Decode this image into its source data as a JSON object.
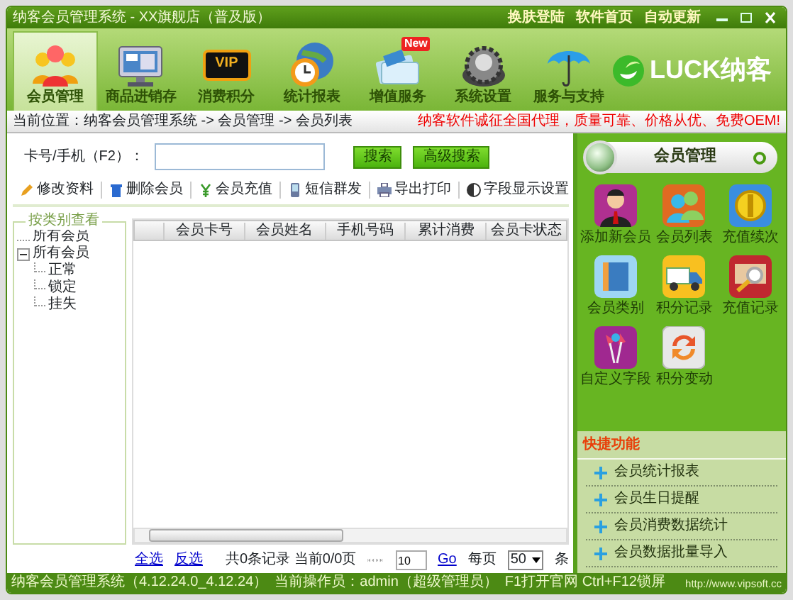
{
  "window": {
    "title": "纳客会员管理系统 - XX旗舰店（普及版）",
    "links": [
      "换肤登陆",
      "软件首页",
      "自动更新"
    ]
  },
  "toolbar": [
    {
      "label": "会员管理",
      "selected": true
    },
    {
      "label": "商品进销存",
      "selected": false
    },
    {
      "label": "消费积分",
      "selected": false,
      "badge": "VIP"
    },
    {
      "label": "统计报表",
      "selected": false
    },
    {
      "label": "增值服务",
      "selected": false,
      "badge": "New"
    },
    {
      "label": "系统设置",
      "selected": false
    },
    {
      "label": "服务与支持",
      "selected": false
    }
  ],
  "logo": {
    "text": "LUCK纳客"
  },
  "breadcrumb": "当前位置：纳客会员管理系统 -> 会员管理 -> 会员列表",
  "notice": "纳客软件诚征全国代理，质量可靠、价格从优、免费OEM!",
  "search": {
    "label": "卡号/手机（F2）：",
    "buttons": [
      "搜索",
      "高级搜索"
    ]
  },
  "actions": [
    "修改资料",
    "删除会员",
    "会员充值",
    "短信群发",
    "导出打印",
    "字段显示设置"
  ],
  "category_panel": {
    "legend": "按类别查看",
    "tree": [
      {
        "label": "所有会员"
      },
      {
        "label": "所有会员",
        "expanded": true,
        "children": [
          {
            "label": "正常"
          },
          {
            "label": "锁定"
          },
          {
            "label": "挂失"
          }
        ]
      }
    ]
  },
  "table": {
    "columns": [
      "会员卡号",
      "会员姓名",
      "手机号码",
      "累计消费",
      "会员卡状态"
    ]
  },
  "pager": {
    "links": [
      "全选",
      "反选"
    ],
    "summary": "共0条记录 当前0/0页",
    "page_input": "10",
    "go": "Go",
    "per_page_label": "每页",
    "per_page": "50",
    "unit": "条"
  },
  "side_panel": {
    "title": "会员管理",
    "items": [
      "添加新会员",
      "会员列表",
      "充值续次",
      "会员类别",
      "积分记录",
      "充值记录",
      "自定义字段",
      "积分变动"
    ]
  },
  "quick": {
    "title": "快捷功能",
    "items": [
      "会员统计报表",
      "会员生日提醒",
      "会员消费数据统计",
      "会员数据批量导入"
    ]
  },
  "status_bar": {
    "items": [
      "纳客会员管理系统（4.12.24.0_4.12.24）",
      "当前操作员：admin（超级管理员）",
      "F1打开官网 Ctrl+F12锁屏"
    ],
    "url": "http://www.vipsoft.cc"
  }
}
